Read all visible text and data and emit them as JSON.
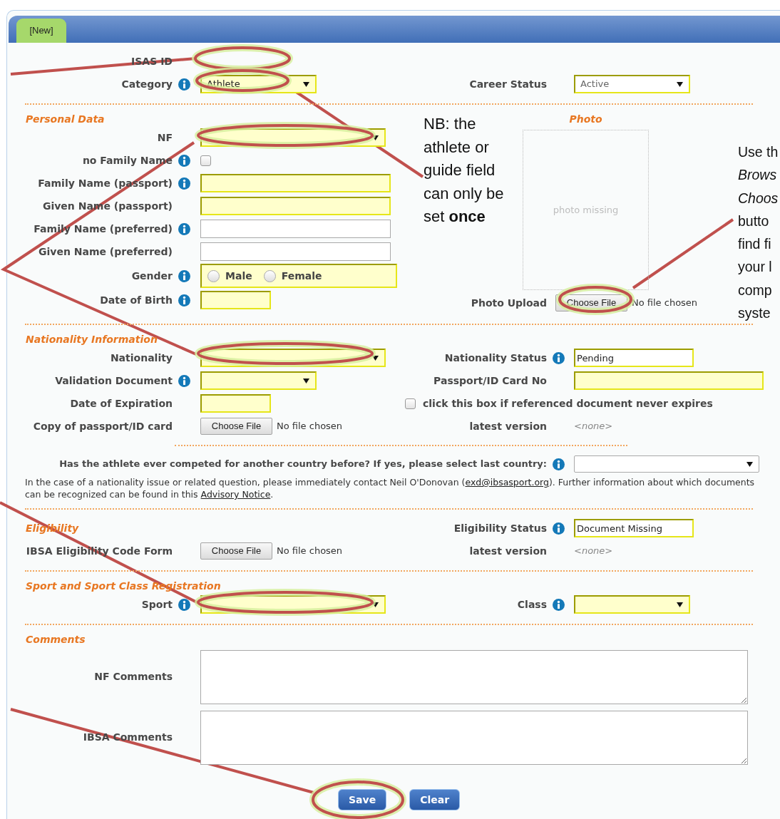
{
  "header": {
    "tab": "[New]"
  },
  "sections": [
    {
      "rows": [
        {
          "left": {
            "label": "ISAS ID",
            "kind": "empty"
          }
        },
        {
          "left": {
            "label": "Category",
            "info": true,
            "kind": "select",
            "value": "Athlete",
            "required": true
          },
          "right": {
            "label": "Career Status",
            "kind": "select",
            "value": "Active",
            "required": false,
            "emphasized": true
          }
        }
      ]
    },
    {
      "title": "Personal Data",
      "rows": [
        {
          "left": {
            "label": "NF",
            "kind": "select",
            "required": true
          }
        },
        {
          "left": {
            "label": "no Family Name",
            "info": true,
            "kind": "checkbox",
            "checked": false
          }
        },
        {
          "left": {
            "label": "Family Name (passport)",
            "info": true,
            "kind": "text",
            "required": true
          }
        },
        {
          "left": {
            "label": "Given Name (passport)",
            "kind": "text",
            "required": true
          }
        },
        {
          "left": {
            "label": "Family Name (preferred)",
            "info": true,
            "kind": "text",
            "required": false,
            "emphasized": false
          }
        },
        {
          "left": {
            "label": "Given Name (preferred)",
            "kind": "text",
            "required": false,
            "emphasized": false
          }
        },
        {
          "left": {
            "label": "Gender",
            "info": true,
            "kind": "radio",
            "required": true,
            "options": [
              {
                "label": "Male",
                "selected": false
              },
              {
                "label": "Female",
                "selected": false
              }
            ]
          }
        },
        {
          "left": {
            "label": "Date of Birth",
            "info": true,
            "kind": "text",
            "required": true
          }
        }
      ],
      "photo": {
        "title": "Photo",
        "placeholder": "photo missing",
        "upload_label": "Photo Upload",
        "button": "Choose File",
        "file_status": "No file chosen"
      }
    },
    {
      "title": "Nationality Information",
      "rows": [
        {
          "left": {
            "label": "Nationality",
            "kind": "select",
            "required": true
          },
          "right": {
            "label": "Nationality Status",
            "info": true,
            "kind": "text",
            "value": "Pending",
            "required": false,
            "emphasized": true
          }
        },
        {
          "left": {
            "label": "Validation Document",
            "info": true,
            "kind": "select",
            "required": true
          },
          "right": {
            "label": "Passport/ID Card No",
            "kind": "text",
            "required": true
          }
        },
        {
          "left": {
            "label": "Date of Expiration",
            "kind": "text",
            "required": true
          },
          "right": {
            "label": "click this box if referenced document never expires",
            "kind": "checkbox_line",
            "checked": false
          }
        },
        {
          "left": {
            "label": "Copy of passport/ID card",
            "kind": "file",
            "button": "Choose File",
            "file_status": "No file chosen"
          },
          "right": {
            "label": "latest version",
            "kind": "static",
            "value": "<none>"
          }
        }
      ],
      "question": {
        "label": "Has the athlete ever competed for another country before? If yes, please select last country:",
        "info": true,
        "required": false,
        "emphasized": false
      },
      "notice": [
        {
          "kind": "text",
          "text": "In the case of a nationality issue or related question, please immediately contact Neil O'Donovan ("
        },
        {
          "kind": "link",
          "text": "exd@ibsasport.org"
        },
        {
          "kind": "text",
          "text": "). Further information about which documents can be recognized can be found in this "
        },
        {
          "kind": "link",
          "text": "Advisory Notice"
        },
        {
          "kind": "text",
          "text": "."
        }
      ]
    },
    {
      "title": "Eligibility",
      "rows": [
        {
          "right": {
            "label": "Eligibility Status",
            "info": true,
            "kind": "text",
            "value": "Document Missing",
            "required": false,
            "emphasized": true
          }
        },
        {
          "left": {
            "label": "IBSA Eligibility Code Form",
            "kind": "file",
            "button": "Choose File",
            "file_status": "No file chosen"
          },
          "right": {
            "label": "latest version",
            "kind": "static",
            "value": "<none>"
          }
        }
      ]
    },
    {
      "title": "Sport and Sport Class Registration",
      "rows": [
        {
          "left": {
            "label": "Sport",
            "info": true,
            "kind": "select",
            "required": true
          },
          "right": {
            "label": "Class",
            "info": true,
            "kind": "select",
            "required": true
          }
        }
      ]
    },
    {
      "title": "Comments",
      "rows": [
        {
          "left": {
            "label": "NF Comments",
            "kind": "textarea"
          }
        },
        {
          "left": {
            "label": "IBSA Comments",
            "kind": "textarea"
          }
        }
      ]
    }
  ],
  "buttons": [
    {
      "label": "Save"
    },
    {
      "label": "Clear"
    }
  ],
  "callouts": {
    "nb": "NB: the athlete or guide field can only be set **once**",
    "right_lines": [
      {
        "text": "Use th",
        "italic": false
      },
      {
        "text": "Brows",
        "italic": true
      },
      {
        "text": "Choos",
        "italic": true
      },
      {
        "text": "butto",
        "italic": false
      },
      {
        "text": "find fi",
        "italic": false
      },
      {
        "text": "your l",
        "italic": false
      },
      {
        "text": "comp",
        "italic": false
      },
      {
        "text": "syste",
        "italic": false
      }
    ]
  }
}
